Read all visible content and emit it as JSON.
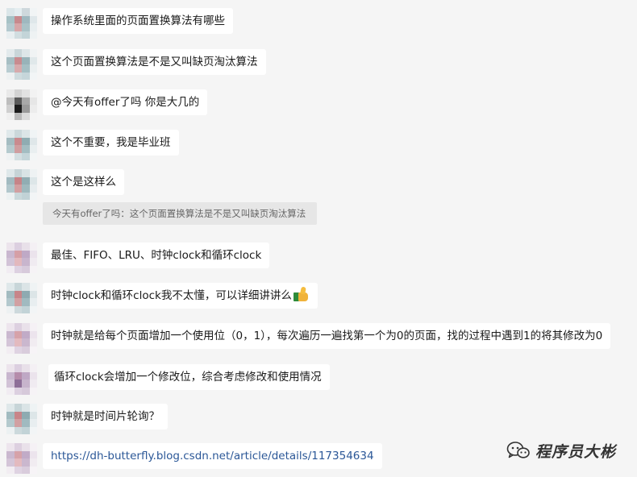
{
  "messages": [
    {
      "text": "操作系统里面的页面置换算法有哪些"
    },
    {
      "text": "这个页面置换算法是不是又叫缺页淘汰算法"
    },
    {
      "text": "@今天有offer了吗 你是大几的"
    },
    {
      "text": "这个不重要，我是毕业班"
    },
    {
      "text": "这个是这样么"
    },
    {
      "text": "最佳、FIFO、LRU、时钟clock和循环clock"
    },
    {
      "text": "时钟clock和循环clock我不太懂，可以详细讲讲么",
      "emoji": "thumbs-up"
    },
    {
      "text": "时钟就是给每个页面增加一个使用位（0，1），每次遍历一遍找第一个为0的页面，找的过程中遇到1的将其修改为0"
    },
    {
      "text": "循环clock会增加一个修改位，综合考虑修改和使用情况"
    },
    {
      "text": "时钟就是时间片轮询？"
    },
    {
      "text": "https://dh-butterfly.blog.csdn.net/article/details/117354634",
      "is_link": true
    }
  ],
  "quote": {
    "text": "今天有offer了吗：这个页面置换算法是不是又叫缺页淘汰算法"
  },
  "watermark": {
    "text": "程序员大彬",
    "icon": "wechat-icon"
  },
  "colors": {
    "background": "#f5f5f5",
    "bubble": "#ffffff",
    "quote_bg": "#e6e6e6",
    "link": "#2b5797"
  }
}
